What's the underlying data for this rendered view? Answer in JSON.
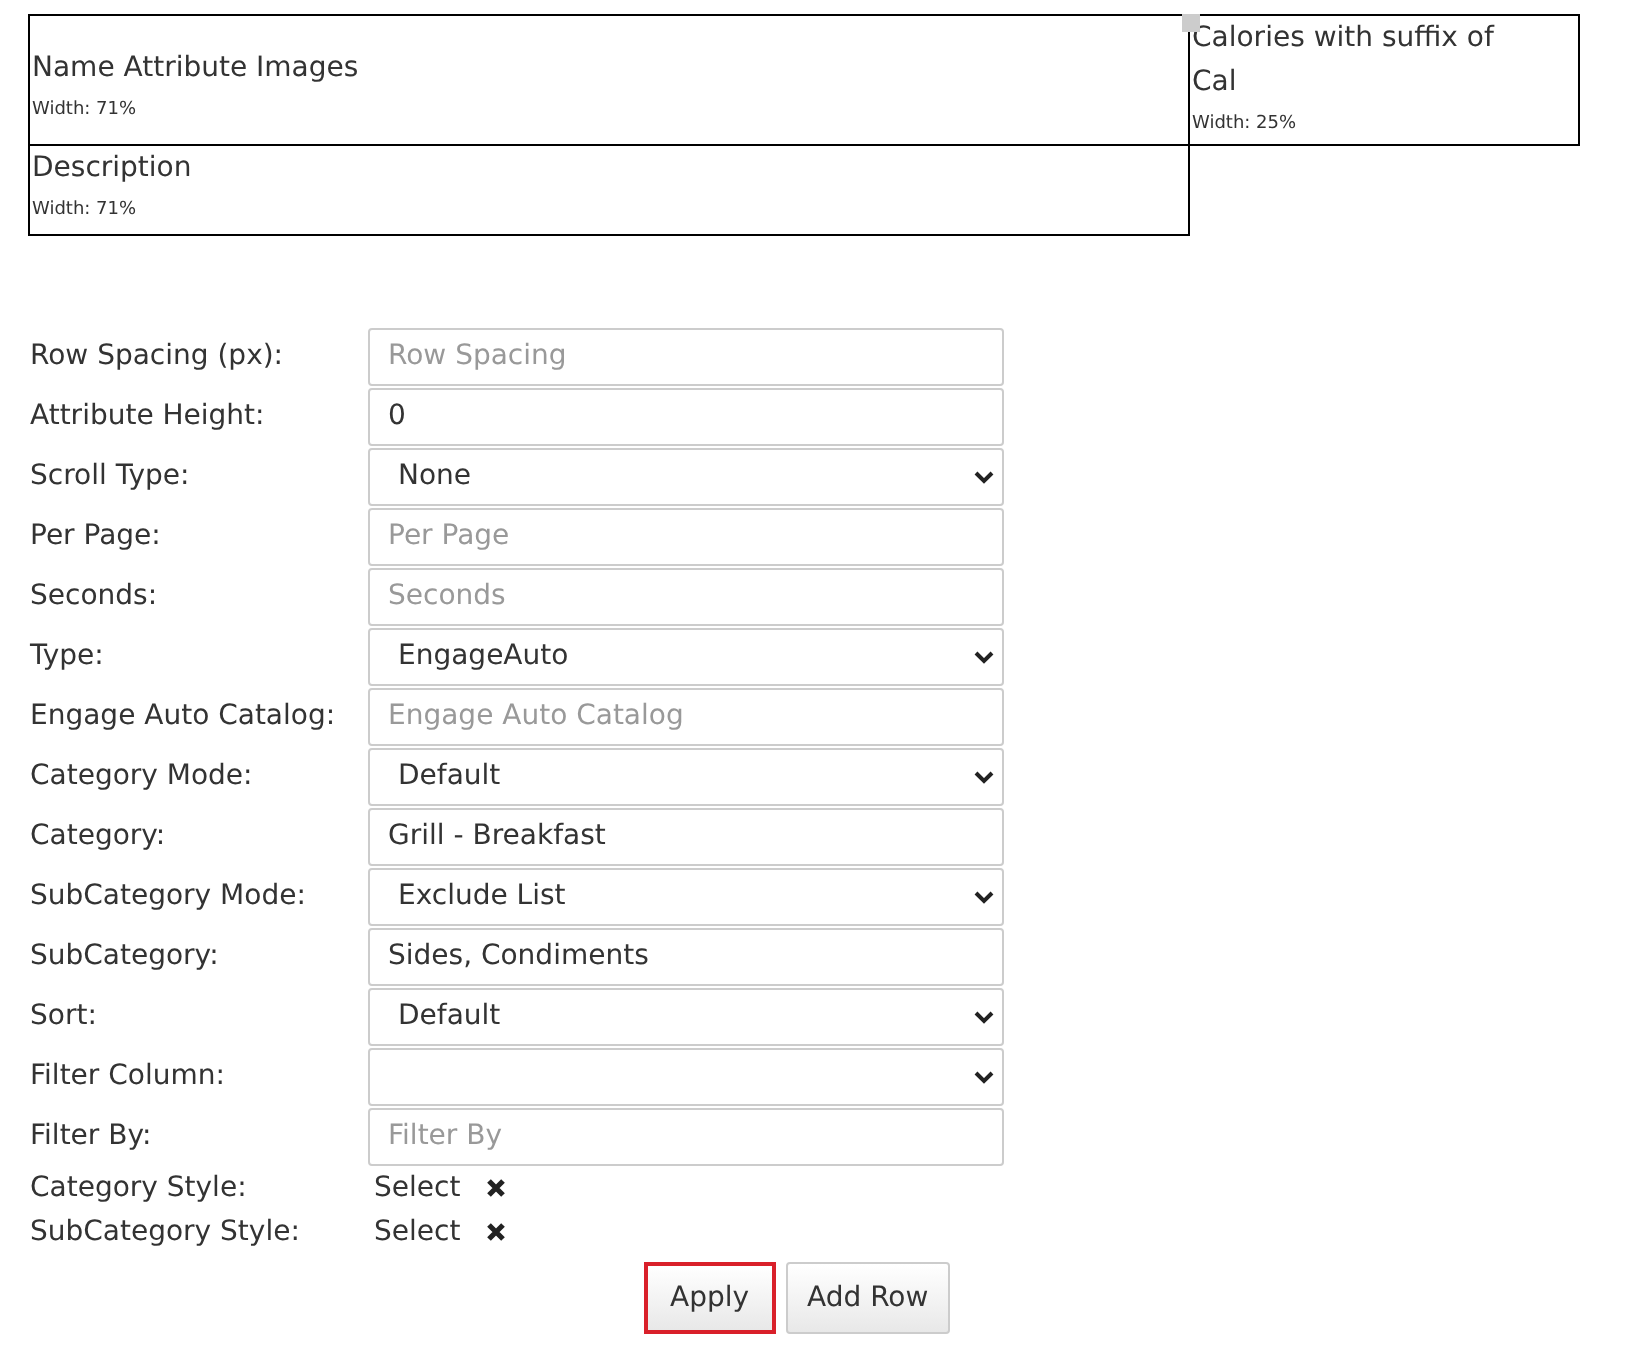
{
  "layout_cells": [
    {
      "title": "Name Attribute Images",
      "width_label": "Width: 71%"
    },
    {
      "title": "Calories with suffix of Cal",
      "width_label": "Width: 25%"
    },
    {
      "title": "Description",
      "width_label": "Width: 71%"
    }
  ],
  "fields": [
    {
      "label": "Row Spacing (px):",
      "kind": "input",
      "placeholder": "Row Spacing"
    },
    {
      "label": "Attribute Height:",
      "kind": "input",
      "value": "0"
    },
    {
      "label": "Scroll Type:",
      "kind": "select",
      "value": "None"
    },
    {
      "label": "Per Page:",
      "kind": "input",
      "placeholder": "Per Page"
    },
    {
      "label": "Seconds:",
      "kind": "input",
      "placeholder": "Seconds"
    },
    {
      "label": "Type:",
      "kind": "select",
      "value": "EngageAuto"
    },
    {
      "label": "Engage Auto Catalog:",
      "kind": "input",
      "placeholder": "Engage Auto Catalog"
    },
    {
      "label": "Category Mode:",
      "kind": "select",
      "value": "Default"
    },
    {
      "label": "Category:",
      "kind": "input",
      "value": "Grill - Breakfast"
    },
    {
      "label": "SubCategory Mode:",
      "kind": "select",
      "value": "Exclude List"
    },
    {
      "label": "SubCategory:",
      "kind": "input",
      "value": "Sides, Condiments"
    },
    {
      "label": "Sort:",
      "kind": "select",
      "value": "Default"
    },
    {
      "label": "Filter Column:",
      "kind": "select"
    },
    {
      "label": "Filter By:",
      "kind": "input",
      "placeholder": "Filter By"
    }
  ],
  "styles": [
    {
      "label": "Category Style:",
      "value": "Select"
    },
    {
      "label": "SubCategory Style:",
      "value": "Select"
    }
  ],
  "buttons": [
    {
      "label": "Apply",
      "focused": true
    },
    {
      "label": "Add Row",
      "focused": false
    }
  ]
}
